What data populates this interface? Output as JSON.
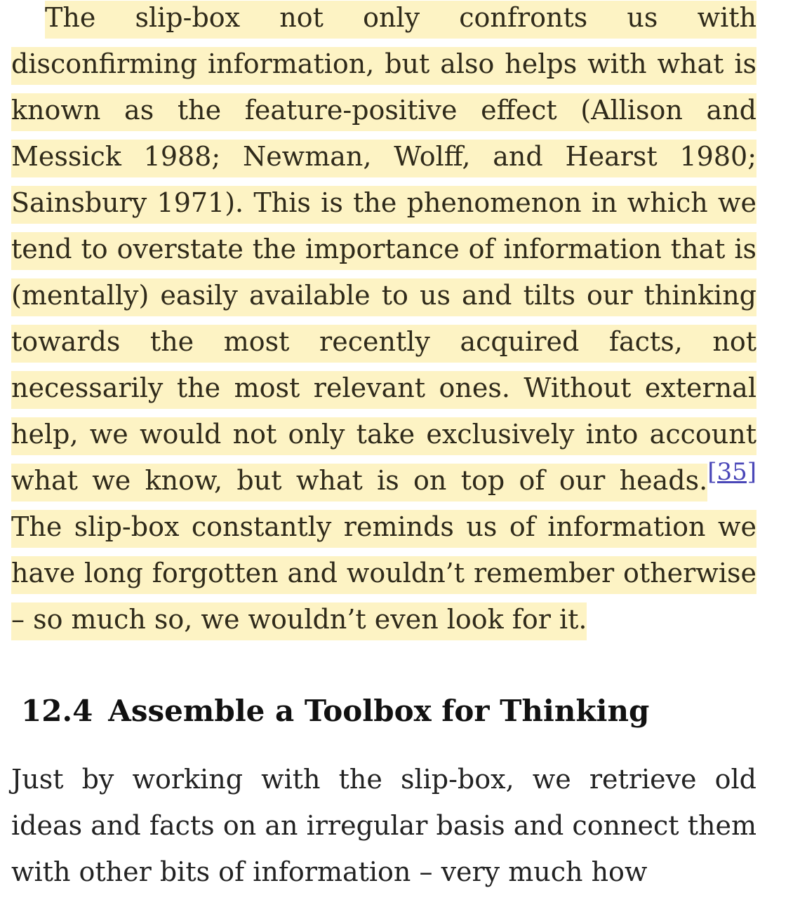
{
  "paragraph1": {
    "before_footnote": "The slip-box not only confronts us with disconfirming information, but also helps with what is known as the feature-positive effect (Allison and Messick 1988; Newman, Wolff, and Hearst 1980; Sainsbury 1971). This is the phenomenon in which we tend to overstate the importance of information that is (mentally) easily available to us and tilts our thinking towards the most recently acquired facts, not necessarily the most relevant ones. Without external help, we would not only take exclusively into account what we know, but what is on top of our heads.",
    "footnote": "[35]",
    "after_footnote": "The slip-box constantly reminds us of information we have long forgotten and wouldn’t remember otherwise – so much so, we wouldn’t even look for it."
  },
  "section": {
    "number": "12.4",
    "title": "Assemble a Toolbox for Thinking"
  },
  "paragraph2": {
    "text": "Just by working with the slip-box, we retrieve old ideas and facts on an irregular basis and connect them with other bits of information – very much how"
  },
  "colors": {
    "highlight": "#fdf3c4",
    "footnote_link": "#4a47b8",
    "text": "#222222"
  }
}
